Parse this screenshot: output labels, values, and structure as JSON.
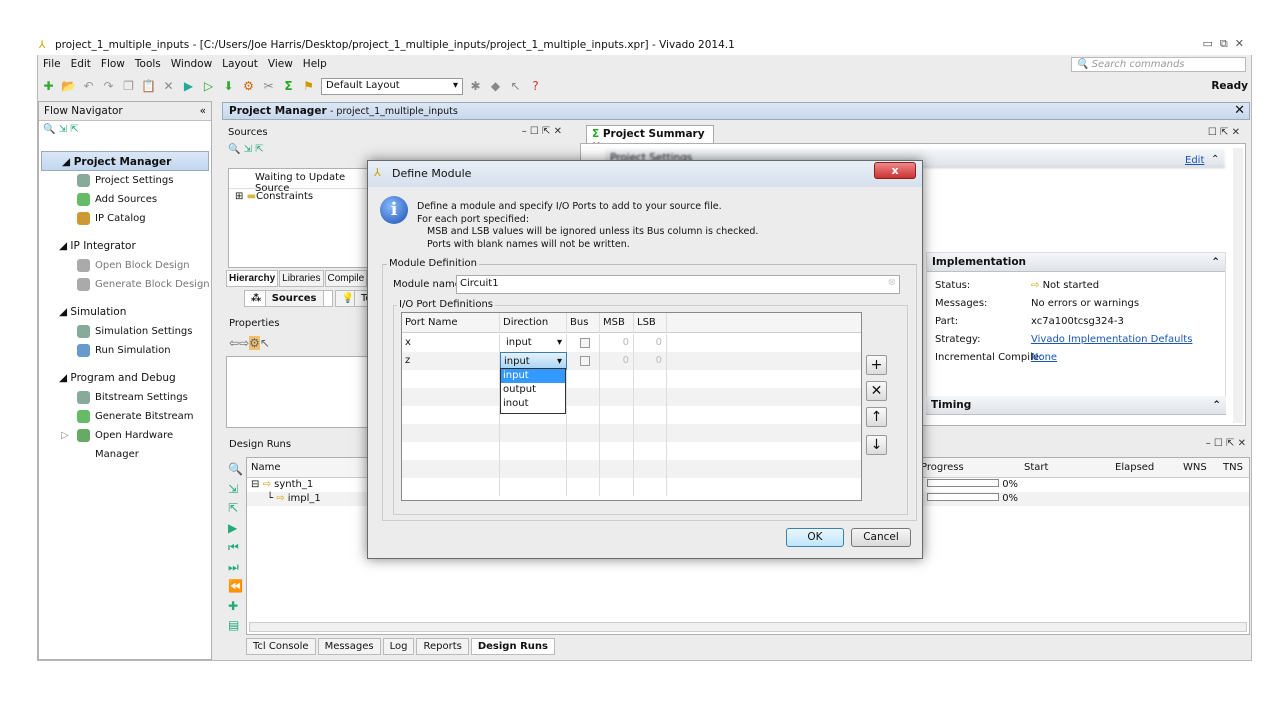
{
  "window": {
    "title": "project_1_multiple_inputs - [C:/Users/Joe Harris/Desktop/project_1_multiple_inputs/project_1_multiple_inputs.xpr] - Vivado 2014.1",
    "status": "Ready"
  },
  "menu": [
    "File",
    "Edit",
    "Flow",
    "Tools",
    "Window",
    "Layout",
    "View",
    "Help"
  ],
  "toolbar": {
    "layout": "Default Layout",
    "search_placeholder": "Search commands"
  },
  "nav": {
    "title": "Flow Navigator",
    "sections": [
      {
        "label": "Project Manager",
        "items": [
          "Project Settings",
          "Add Sources",
          "IP Catalog"
        ]
      },
      {
        "label": "IP Integrator",
        "items": [
          "Open Block Design",
          "Generate Block Design"
        ]
      },
      {
        "label": "Simulation",
        "items": [
          "Simulation Settings",
          "Run Simulation"
        ]
      },
      {
        "label": "Program and Debug",
        "items": [
          "Bitstream Settings",
          "Generate Bitstream",
          "Open Hardware Manager"
        ]
      }
    ]
  },
  "pm": {
    "title": "Project Manager",
    "subtitle": "- project_1_multiple_inputs"
  },
  "sources": {
    "title": "Sources",
    "waiting": "Waiting to Update Source",
    "tree": "Constraints",
    "tabs": [
      "Hierarchy",
      "Libraries",
      "Compile"
    ],
    "subtabs": [
      "Sources",
      "Templates"
    ]
  },
  "properties": {
    "title": "Properties"
  },
  "summary": {
    "tab": "Project Summary",
    "settings": "Project Settings",
    "edit": "Edit",
    "impl": {
      "title": "Implementation",
      "rows": [
        [
          "Status:",
          "Not started"
        ],
        [
          "Messages:",
          "No errors or warnings"
        ],
        [
          "Part:",
          "xc7a100tcsg324-3"
        ],
        [
          "Strategy:",
          "Vivado Implementation Defaults"
        ],
        [
          "Incremental Compile:",
          "None"
        ]
      ]
    },
    "timing": "Timing"
  },
  "runs": {
    "title": "Design Runs",
    "cols": [
      "Name",
      "Progress",
      "Start",
      "Elapsed",
      "WNS",
      "TNS"
    ],
    "rows": [
      {
        "name": "synth_1",
        "progress": "0%"
      },
      {
        "name": "impl_1",
        "progress": "0%"
      }
    ]
  },
  "bottom_tabs": [
    "Tcl Console",
    "Messages",
    "Log",
    "Reports",
    "Design Runs"
  ],
  "dialog": {
    "title": "Define Module",
    "info": [
      "Define a module and specify I/O Ports to add to your source file.",
      "For each port specified:",
      "MSB and LSB values will be ignored unless its Bus column is checked.",
      "Ports with blank names will not be written."
    ],
    "module_def": "Module Definition",
    "module_label": "Module name:",
    "module_name": "Circuit1",
    "io_label": "I/O Port Definitions",
    "cols": [
      "Port Name",
      "Direction",
      "Bus",
      "MSB",
      "LSB"
    ],
    "ports": [
      {
        "name": "x",
        "dir": "input",
        "msb": "0",
        "lsb": "0"
      },
      {
        "name": "z",
        "dir": "input",
        "msb": "0",
        "lsb": "0"
      }
    ],
    "options": [
      "input",
      "output",
      "inout"
    ],
    "ok": "OK",
    "cancel": "Cancel"
  }
}
